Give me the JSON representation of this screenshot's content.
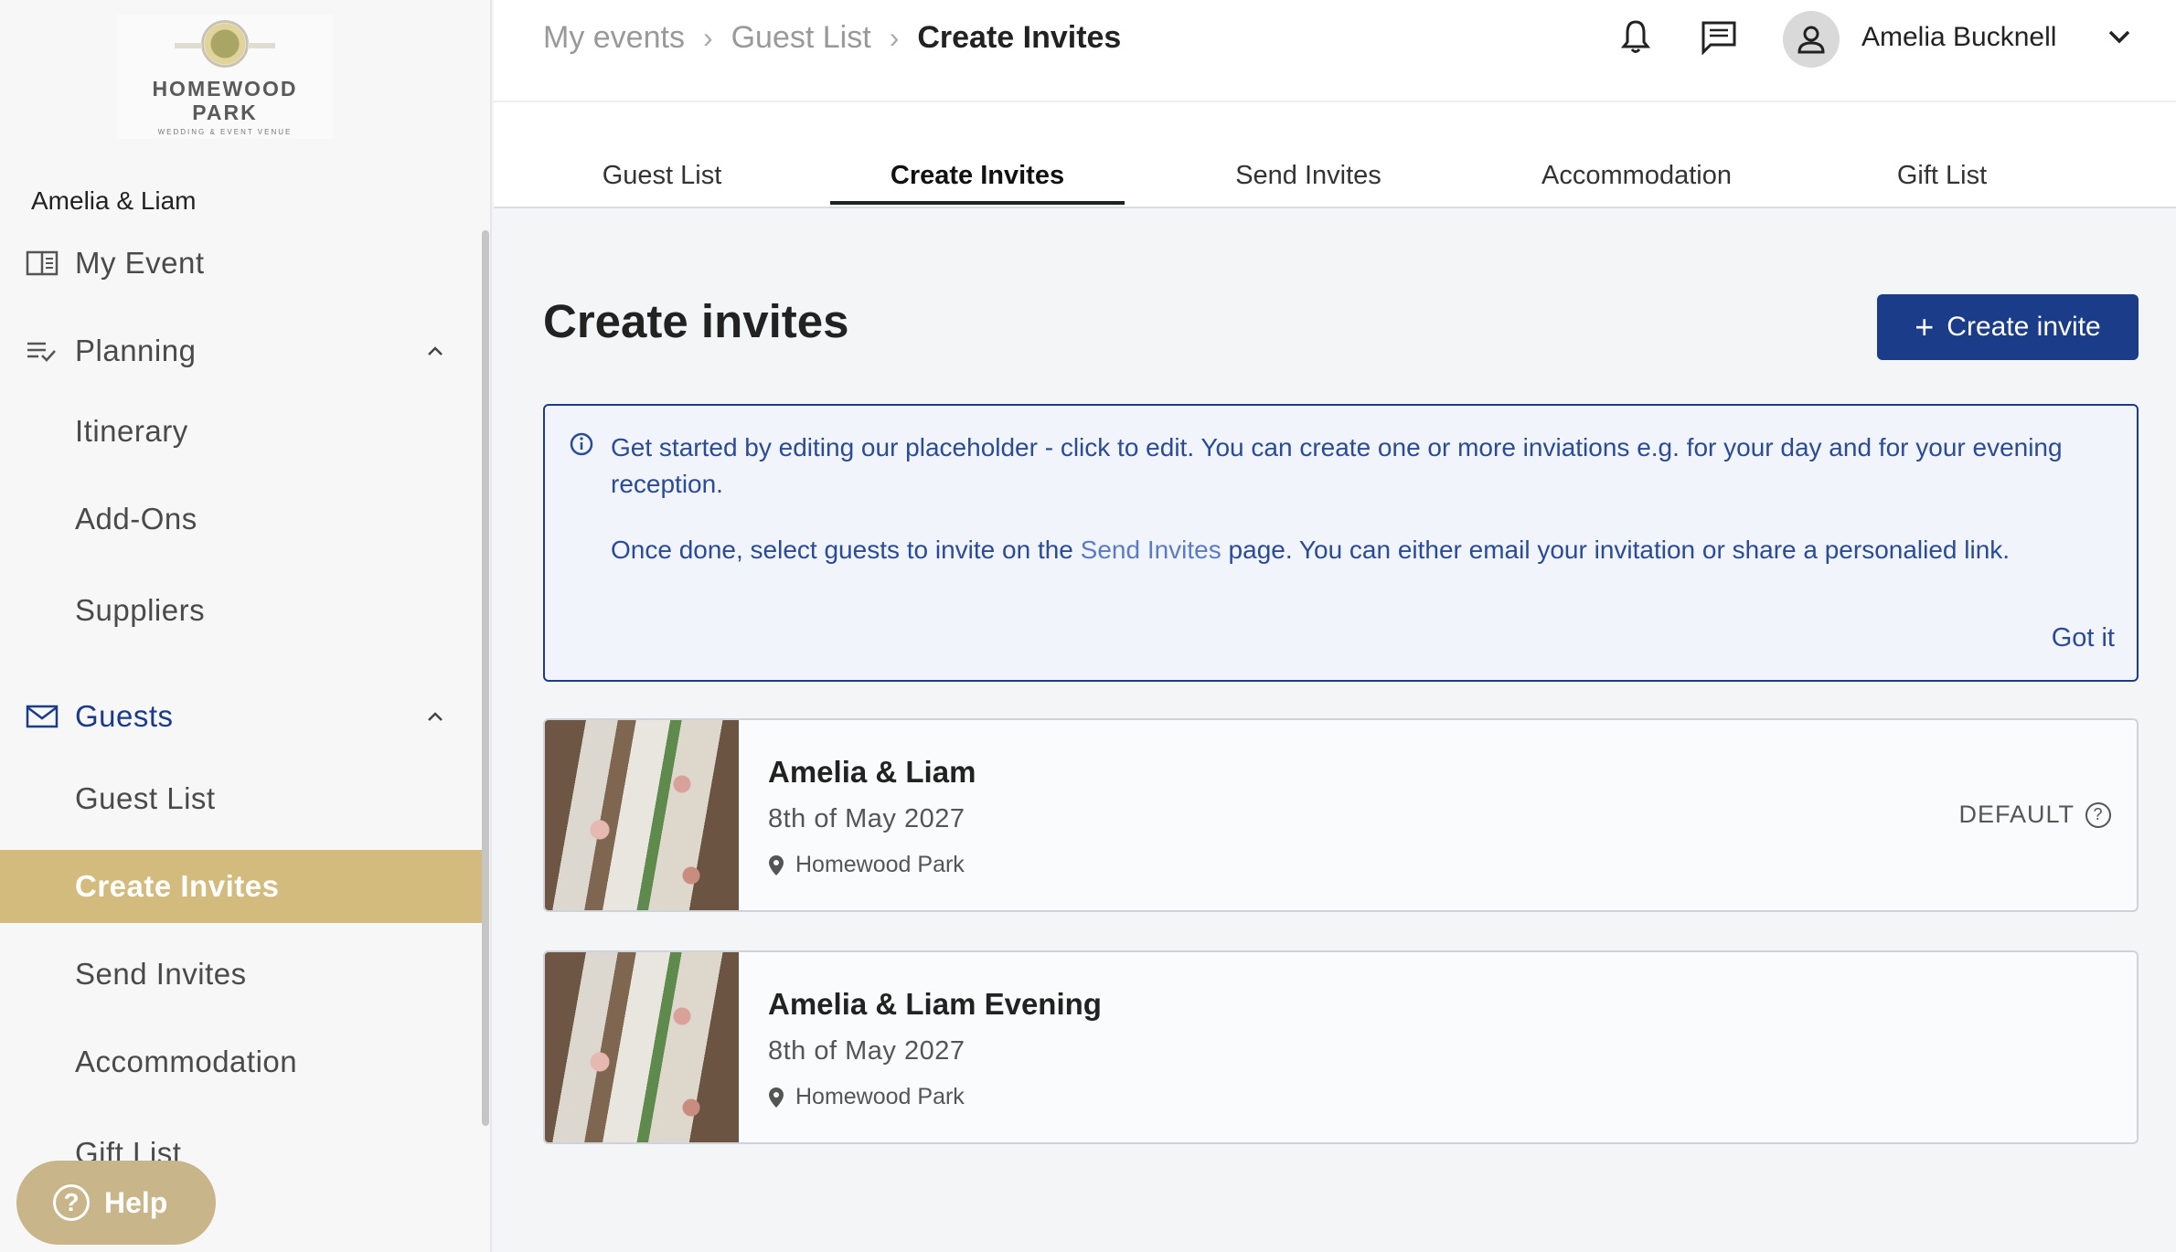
{
  "logo": {
    "line1": "HOMEWOOD",
    "line2": "PARK",
    "line3": "WEDDING & EVENT VENUE"
  },
  "sidebar": {
    "couple": "Amelia & Liam",
    "items": [
      {
        "label": "My Event"
      },
      {
        "label": "Planning"
      },
      {
        "label": "Itinerary"
      },
      {
        "label": "Add-Ons"
      },
      {
        "label": "Suppliers"
      },
      {
        "label": "Guests"
      },
      {
        "label": "Guest List"
      },
      {
        "label": "Create Invites"
      },
      {
        "label": "Send Invites"
      },
      {
        "label": "Accommodation"
      },
      {
        "label": "Gift List"
      }
    ],
    "help_label": "Help"
  },
  "breadcrumb": {
    "items": [
      "My events",
      "Guest List"
    ],
    "current": "Create Invites"
  },
  "user": {
    "name": "Amelia Bucknell"
  },
  "tabs": [
    "Guest List",
    "Create Invites",
    "Send Invites",
    "Accommodation",
    "Gift List"
  ],
  "main": {
    "title": "Create invites",
    "create_button": "Create invite",
    "info": {
      "p1": "Get started by editing our placeholder - click to edit. You can create one or more inviations e.g. for your day and for your evening reception.",
      "p2_before": "Once done, select guests to invite on the ",
      "p2_link": "Send Invites",
      "p2_after": " page. You can either email your invitation or share a personalied link.",
      "dismiss": "Got it"
    },
    "invites": [
      {
        "title": "Amelia & Liam",
        "date": "8th of May 2027",
        "location": "Homewood Park",
        "badge": "DEFAULT"
      },
      {
        "title": "Amelia & Liam Evening",
        "date": "8th of May 2027",
        "location": "Homewood Park",
        "badge": ""
      }
    ]
  },
  "colors": {
    "primary": "#1a3c89",
    "selected": "#d2bb7c",
    "help": "#c9b58a"
  }
}
